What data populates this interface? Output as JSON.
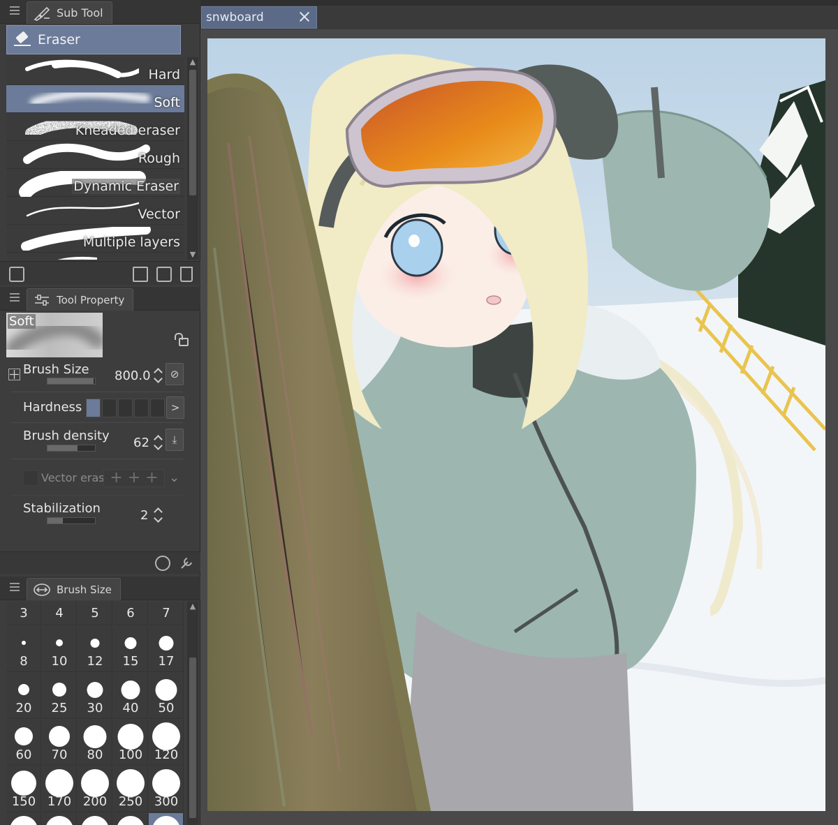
{
  "panels": {
    "subtool": {
      "tab_label": "Sub Tool",
      "group_label": "Eraser",
      "tools": [
        {
          "label": "Hard",
          "selected": false
        },
        {
          "label": "Soft",
          "selected": true
        },
        {
          "label": "Kneaded eraser",
          "selected": false
        },
        {
          "label": "Rough",
          "selected": false
        },
        {
          "label": "Dynamic Eraser",
          "selected": false
        },
        {
          "label": "Vector",
          "selected": false
        },
        {
          "label": "Multiple layers",
          "selected": false
        }
      ]
    },
    "property": {
      "tab_label": "Tool Property",
      "preview_label": "Soft",
      "brush_size_label": "Brush Size",
      "brush_size_value": "800.0",
      "hardness_label": "Hardness",
      "hardness_level": 1,
      "hardness_steps": 5,
      "density_label": "Brush density",
      "density_value": "62",
      "vector_erase_label": "Vector erase",
      "stabilization_label": "Stabilization",
      "stabilization_value": "2"
    },
    "brushsize": {
      "tab_label": "Brush Size",
      "sizes": [
        "3",
        "4",
        "5",
        "6",
        "7",
        "8",
        "10",
        "12",
        "15",
        "17",
        "20",
        "25",
        "30",
        "40",
        "50",
        "60",
        "70",
        "80",
        "100",
        "120",
        "150",
        "170",
        "200",
        "250",
        "300"
      ],
      "selected_index": 29
    }
  },
  "document": {
    "tab_title": "snwboard"
  },
  "icons": {
    "subtool_tab": "pen-brush-icon",
    "property_tab": "sliders-icon",
    "brushsize_tab": "brush-size-icon",
    "close": "close-icon",
    "lock": "lock-icon"
  },
  "colors": {
    "accent": "#6b7b99",
    "panel": "#3d3d3d",
    "panel_header": "#353535",
    "canvas_bg": "#494949",
    "tab_active": "#5b6a86"
  }
}
